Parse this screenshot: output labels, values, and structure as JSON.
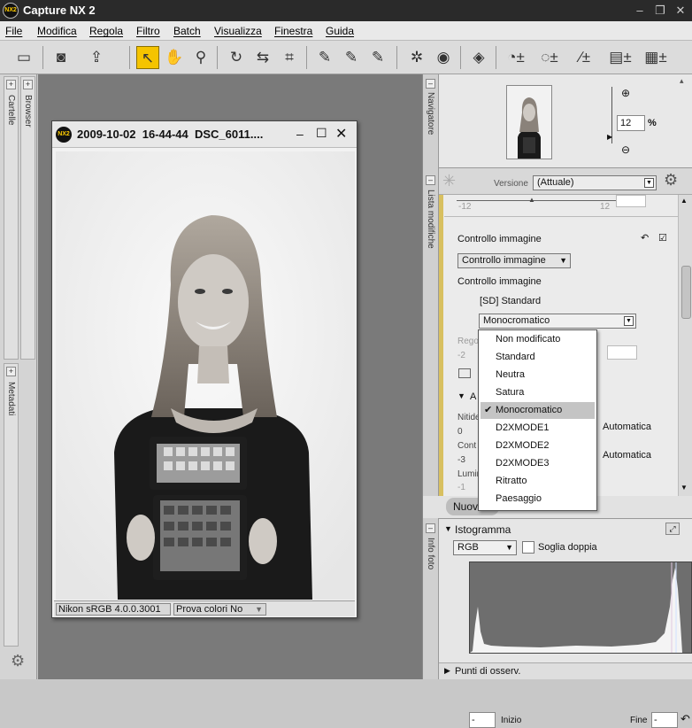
{
  "app": {
    "title": "Capture NX 2",
    "logo": "NX2"
  },
  "menu": [
    "File",
    "Modifica",
    "Regola",
    "Filtro",
    "Batch",
    "Visualizza",
    "Finestra",
    "Guida"
  ],
  "left_dock": {
    "browser": "Browser",
    "cartelle": "Cartelle",
    "metadati": "Metadati"
  },
  "image_window": {
    "title": "2009-10-02  16-44-44  DSC_6011....",
    "profile": "Nikon sRGB 4.0.0.3001",
    "soft_proof": "Prova colori No"
  },
  "navigator": {
    "label": "Navigatore",
    "zoom": "12",
    "zoom_unit": "%"
  },
  "edit_list": {
    "label": "Lista modifiche",
    "versione_label": "Versione",
    "versione_value": "(Attuale)",
    "slider_min": "-12",
    "slider_max": "12",
    "section_title": "Controllo immagine",
    "picture_control_select": "Controllo immagine",
    "picture_control_label": "Controllo immagine",
    "current_setting": "[SD] Standard",
    "mode_select": "Monocromatico",
    "regola_label": "Regol",
    "regola_value": "-2",
    "a_label": "A",
    "nitidezza_label": "Nitide",
    "nitidezza_value": "0",
    "contrasto_label": "Cont",
    "contrasto_value": "-3",
    "luminosita_label": "Lumin",
    "luminosita_value": "-1",
    "automatica1": "Automatica",
    "automatica2": "Automatica",
    "nuovo_button": "Nuov"
  },
  "dropdown": {
    "items": [
      "Non modificato",
      "Standard",
      "Neutra",
      "Satura",
      "Monocromatico",
      "D2XMODE1",
      "D2XMODE2",
      "D2XMODE3",
      "Ritratto",
      "Paesaggio"
    ],
    "selected": "Monocromatico"
  },
  "histogram": {
    "label": "Istogramma",
    "info_label": "Info foto",
    "channel": "RGB",
    "threshold_label": "Soglia doppia",
    "start_label": "Inizio",
    "start_value": "-",
    "end_label": "Fine",
    "end_value": "-",
    "points_label": "Punti di osserv."
  },
  "colors": {
    "accent": "#f5c400",
    "title_bg": "#2a2a2a",
    "workspace": "#7a7a7a"
  }
}
